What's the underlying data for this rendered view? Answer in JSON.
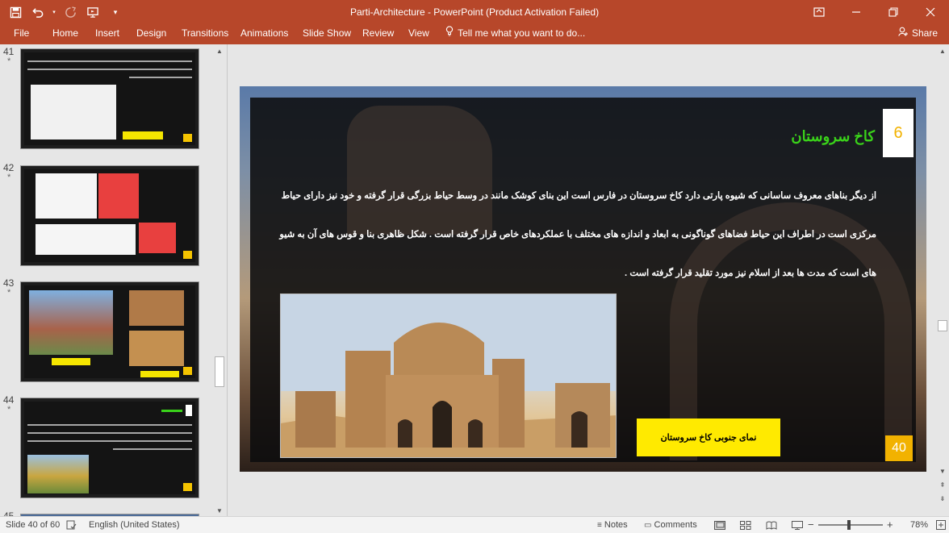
{
  "app": {
    "title": "Parti-Architecture - PowerPoint (Product Activation Failed)"
  },
  "qat": {
    "save": "save-icon",
    "undo": "undo-icon",
    "redo": "redo-icon",
    "present": "present-from-start-icon",
    "customize": "customize-icon"
  },
  "window": {
    "ribbon_display": "ribbon-display-icon",
    "minimize": "minimize-icon",
    "restore": "restore-icon",
    "close": "close-icon"
  },
  "ribbon": {
    "tabs": [
      "File",
      "Home",
      "Insert",
      "Design",
      "Transitions",
      "Animations",
      "Slide Show",
      "Review",
      "View"
    ],
    "tell_me": "Tell me what you want to do...",
    "share": "Share"
  },
  "thumbnails": [
    {
      "number": "41",
      "star": "*"
    },
    {
      "number": "42",
      "star": "*"
    },
    {
      "number": "43",
      "star": "*"
    },
    {
      "number": "44",
      "star": "*"
    },
    {
      "number": "45",
      "star": ""
    }
  ],
  "slide": {
    "number_box": "6",
    "title": "کاخ سروستان",
    "paragraph_lines": [
      "از دیگر بناهای معروف ساسانی که شیوه پارتی دارد کاخ سروستان در فارس است این بنای کوشک مانند در وسط حیاط بزرگی قرار گرفته و خود نیز دارای حیاط",
      "مرکزی است در اطراف این حیاط فضاهای گوناگونی به ابعاد و اندازه های مختلف با عملکردهای خاص قرار گرفته است . شکل ظاهری بنا و قوس های آن به شیو",
      "های است که مدت ها بعد از اسلام نیز مورد تقلید قرار گرفته است ."
    ],
    "caption": "نمای جنوبی کاخ سروستان",
    "page_number": "40",
    "accent_colors": {
      "title": "#3ad21a",
      "caption_bg": "#ffea00",
      "page_bg": "#f2b200"
    }
  },
  "status": {
    "slide_info": "Slide 40 of 60",
    "language": "English (United States)",
    "notes": "Notes",
    "comments": "Comments",
    "zoom": "78%",
    "zoom_level": 0.78
  }
}
